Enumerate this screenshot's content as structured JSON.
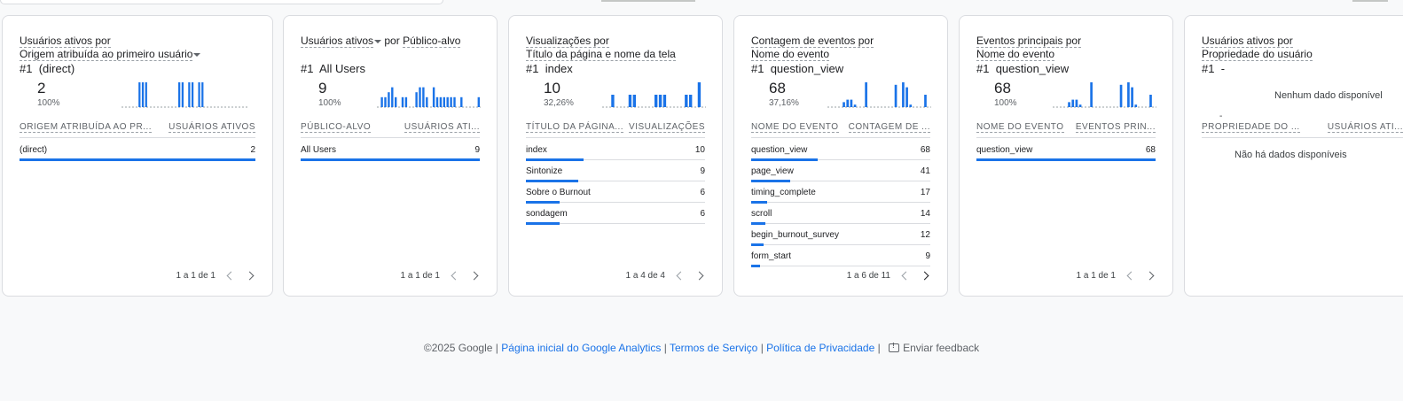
{
  "cards": [
    {
      "title_line1": "Usuários ativos por",
      "title_line2": "Origem atribuída ao primeiro usuário",
      "top_rank": "#1",
      "top_value": "(direct)",
      "big_number": "2",
      "percent": "100%",
      "col1": "ORIGEM ATRIBUÍDA AO PR...",
      "col2": "USUÁRIOS ATIVOS",
      "rows": [
        {
          "label": "(direct)",
          "value": "2",
          "fraction": 1.0
        }
      ],
      "sparkline": [
        0,
        0,
        0,
        0,
        0,
        1,
        1,
        1,
        0,
        0,
        0,
        0,
        0,
        0,
        0,
        0,
        0,
        1,
        1,
        0,
        1,
        1,
        0,
        1,
        1,
        0,
        0,
        0,
        0,
        0,
        0,
        0,
        0,
        0,
        0,
        0,
        0,
        0
      ],
      "pager": "1 a 1 de 1",
      "next_active": false
    },
    {
      "title_line1": "Usuários ativos",
      "title_line1_suffix": "por",
      "title_line1_dim": "Público-alvo",
      "top_rank": "#1",
      "top_value": "All Users",
      "big_number": "9",
      "percent": "100%",
      "col1": "PÚBLICO-ALVO",
      "col2": "USUÁRIOS ATI...",
      "rows": [
        {
          "label": "All Users",
          "value": "9",
          "fraction": 1.0
        }
      ],
      "sparkline": [
        0,
        0.4,
        0.4,
        0.6,
        0.8,
        0.4,
        0,
        0.4,
        0.4,
        0,
        0,
        0.6,
        0.8,
        0.8,
        0.4,
        0,
        0.8,
        0.4,
        0.4,
        0.4,
        0.4,
        0.4,
        0.4,
        0,
        0.4,
        0,
        0,
        0,
        0,
        0.4
      ],
      "pager": "1 a 1 de 1",
      "next_active": false
    },
    {
      "title_line1": "Visualizações por",
      "title_line2": "Título da página e nome da tela",
      "top_rank": "#1",
      "top_value": "index",
      "big_number": "10",
      "percent": "32,26%",
      "col1": "TÍTULO DA PÁGINA...",
      "col2": "VISUALIZAÇÕES",
      "rows": [
        {
          "label": "index",
          "value": "10",
          "fraction": 0.32
        },
        {
          "label": "Sintonize",
          "value": "9",
          "fraction": 0.29
        },
        {
          "label": "Sobre o Burnout",
          "value": "6",
          "fraction": 0.19
        },
        {
          "label": "sondagem",
          "value": "6",
          "fraction": 0.19
        }
      ],
      "sparkline": [
        0,
        0,
        0.5,
        0,
        0,
        0,
        0.5,
        0.5,
        0,
        0,
        0,
        0,
        0.5,
        0.5,
        0.5,
        0,
        0,
        0,
        0,
        0.5,
        0.5,
        0,
        1,
        0
      ],
      "pager": "1 a 4 de 4",
      "next_active": false
    },
    {
      "title_line1": "Contagem de eventos por",
      "title_line2": "Nome do evento",
      "top_rank": "#1",
      "top_value": "question_view",
      "big_number": "68",
      "percent": "37,16%",
      "col1": "NOME DO EVENTO",
      "col2": "CONTAGEM DE ...",
      "rows": [
        {
          "label": "question_view",
          "value": "68",
          "fraction": 0.37
        },
        {
          "label": "page_view",
          "value": "41",
          "fraction": 0.22
        },
        {
          "label": "timing_complete",
          "value": "17",
          "fraction": 0.09
        },
        {
          "label": "scroll",
          "value": "14",
          "fraction": 0.08
        },
        {
          "label": "begin_burnout_survey",
          "value": "12",
          "fraction": 0.07
        },
        {
          "label": "form_start",
          "value": "9",
          "fraction": 0.05
        }
      ],
      "sparkline": [
        0,
        0,
        0,
        0,
        0.2,
        0.3,
        0.3,
        0.1,
        0,
        0,
        1,
        0,
        0,
        0,
        0,
        0,
        0,
        0,
        0.9,
        0,
        1,
        0.8,
        0.1,
        0,
        0,
        0,
        0.5,
        0
      ],
      "pager": "1 a 6 de 11",
      "next_active": true
    },
    {
      "title_line1": "Eventos principais por",
      "title_line2": "Nome do evento",
      "top_rank": "#1",
      "top_value": "question_view",
      "big_number": "68",
      "percent": "100%",
      "col1": "NOME DO EVENTO",
      "col2": "EVENTOS PRIN...",
      "rows": [
        {
          "label": "question_view",
          "value": "68",
          "fraction": 1.0
        }
      ],
      "sparkline": [
        0,
        0,
        0,
        0,
        0.2,
        0.3,
        0.3,
        0.1,
        0,
        0,
        1,
        0,
        0,
        0,
        0,
        0,
        0,
        0,
        0.9,
        0,
        1,
        0.8,
        0.1,
        0,
        0,
        0,
        0.5,
        0
      ],
      "pager": "1 a 1 de 1",
      "next_active": false
    },
    {
      "title_line1": "Usuários ativos por",
      "title_line2": "Propriedade do usuário",
      "top_rank": "#1",
      "top_value": "-",
      "spark_dash": "-",
      "spark_nodata": "Nenhum dado disponível",
      "col1": "PROPRIEDADE DO ...",
      "col2": "USUÁRIOS ATI...",
      "nodata": "Não há dados disponíveis"
    }
  ],
  "footer": {
    "copyright": "©2025 Google",
    "link1": "Página inicial do Google Analytics",
    "link2": "Termos de Serviço",
    "link3": "Política de Privacidade",
    "feedback": "Enviar feedback",
    "sep": "|"
  },
  "colors": {
    "accent": "#1a73e8",
    "border": "#dadce0",
    "background": "#f8f9fa"
  }
}
